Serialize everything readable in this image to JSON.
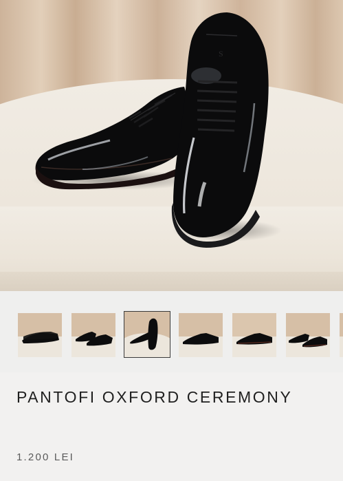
{
  "product": {
    "title": "PANTOFI OXFORD CEREMONY",
    "price": "1.200 LEI"
  },
  "gallery": {
    "selected_index": 2,
    "thumbnails": [
      {
        "name": "gallery-thumbnail-1"
      },
      {
        "name": "gallery-thumbnail-2"
      },
      {
        "name": "gallery-thumbnail-3"
      },
      {
        "name": "gallery-thumbnail-4"
      },
      {
        "name": "gallery-thumbnail-5"
      },
      {
        "name": "gallery-thumbnail-6"
      },
      {
        "name": "gallery-thumbnail-7"
      }
    ]
  },
  "colors": {
    "background": "#f2f1f0",
    "text": "#1f1f1f",
    "muted_text": "#5a5a5a",
    "curtain": "#d8c3aa",
    "table": "#efe9e0",
    "shoe": "#0b0b0c"
  }
}
